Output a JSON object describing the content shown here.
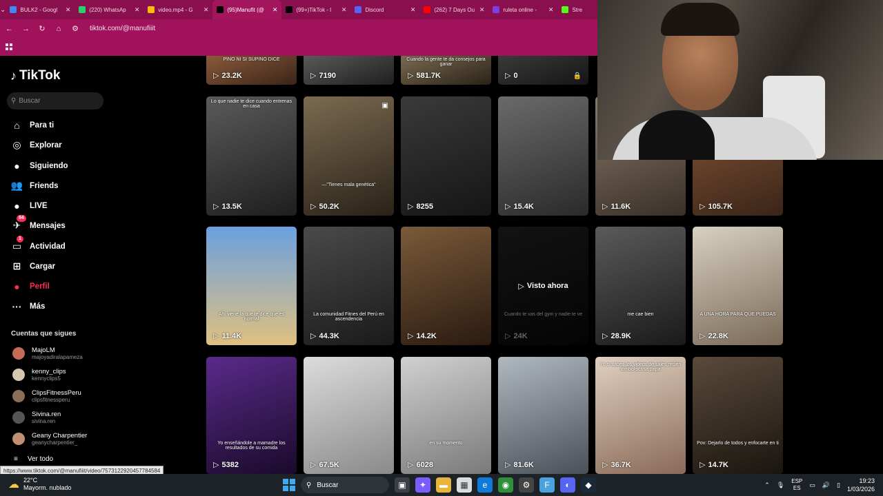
{
  "browser": {
    "tabs": [
      {
        "title": "BULK2 - Googl",
        "color": "#4285f4"
      },
      {
        "title": "(220) WhatsAp",
        "color": "#25d366"
      },
      {
        "title": "video.mp4 - G",
        "color": "#fbbc04"
      },
      {
        "title": "(95)Manufit (@",
        "color": "#000000",
        "active": true
      },
      {
        "title": "(99+)TikTok - l",
        "color": "#000000"
      },
      {
        "title": "Discord",
        "color": "#5865f2"
      },
      {
        "title": "(262) 7 Days Ou",
        "color": "#ff0000"
      },
      {
        "title": "ruleta online -",
        "color": "#7b3fe4"
      },
      {
        "title": "Stre",
        "color": "#53fc18"
      }
    ],
    "url": "tiktok.com/@manufiiit",
    "status_url": "https://www.tiktok.com/@manufiiit/video/7573122920457784584"
  },
  "sidebar": {
    "brand": "TikTok",
    "search_placeholder": "Buscar",
    "nav": [
      {
        "label": "Para ti",
        "icon": "home-icon",
        "glyph": "⌂"
      },
      {
        "label": "Explorar",
        "icon": "compass-icon",
        "glyph": "◎"
      },
      {
        "label": "Siguiendo",
        "icon": "following-avatar-icon",
        "glyph": "●"
      },
      {
        "label": "Friends",
        "icon": "friends-icon",
        "glyph": "👥"
      },
      {
        "label": "LIVE",
        "icon": "live-icon",
        "glyph": "●"
      },
      {
        "label": "Mensajes",
        "icon": "messages-icon",
        "glyph": "✈",
        "badge": "94"
      },
      {
        "label": "Actividad",
        "icon": "activity-icon",
        "glyph": "▭",
        "badge": "1"
      },
      {
        "label": "Cargar",
        "icon": "upload-icon",
        "glyph": "⊞"
      },
      {
        "label": "Perfil",
        "icon": "profile-icon",
        "glyph": "●",
        "active": true
      },
      {
        "label": "Más",
        "icon": "more-icon",
        "glyph": "···"
      }
    ],
    "following_title": "Cuentas que sigues",
    "following": [
      {
        "name": "MajoLM",
        "handle": "majoyadiralapameza"
      },
      {
        "name": "kenny_clips",
        "handle": "kennyclips5"
      },
      {
        "name": "ClipsFitnessPeru",
        "handle": "clipsfitnessperu"
      },
      {
        "name": "Sivina.ren",
        "handle": "sivina.ren"
      },
      {
        "name": "Geany Charpentier",
        "handle": "geanycharpentier_"
      }
    ],
    "see_all": "Ver todo"
  },
  "grid": {
    "row0": [
      {
        "views": "23.2K",
        "caption": "PINO NI SI SUPINO DICE"
      },
      {
        "views": "7190"
      },
      {
        "views": "581.7K",
        "caption": "Cuando la gente te da consejos para ganar"
      },
      {
        "views": "0",
        "locked": true
      }
    ],
    "row1": [
      {
        "views": "13.5K",
        "caption": "Lo que nadie te dice cuando entrenas en casa"
      },
      {
        "views": "50.2K",
        "caption": "—\"Tienes mala genética\""
      },
      {
        "views": "8255"
      },
      {
        "views": "15.4K"
      },
      {
        "views": "11.6K"
      },
      {
        "views": "105.7K"
      }
    ],
    "row2": [
      {
        "views": "11.4K",
        "caption": "Ahí viene la que te dice que es normal"
      },
      {
        "views": "44.3K",
        "caption": "La comunidad Fitnes del Perú en ascendencia"
      },
      {
        "views": "14.2K"
      },
      {
        "views": "24K",
        "overlay": "Visto ahora",
        "caption": "Cuando te vas del gym y nadie te ve"
      },
      {
        "views": "28.9K",
        "caption": "me cae bien"
      },
      {
        "views": "22.8K",
        "caption": "A UNA HORA PARA QUE PUEDAS"
      }
    ],
    "row3": [
      {
        "views": "5382",
        "caption": "Yo enseñándole a mamadre los resultados de su comida"
      },
      {
        "views": "67.5K"
      },
      {
        "views": "6028",
        "caption": "en su momento"
      },
      {
        "views": "81.6K"
      },
      {
        "views": "36.7K",
        "caption": "Yo si sabes los videos de sales recién tomborocosa papa"
      },
      {
        "views": "14.7K",
        "caption": "Pov: Dejarlo de todos y enfocarte en ti"
      }
    ]
  },
  "taskbar": {
    "weather_temp": "22°C",
    "weather_desc": "Mayorm. nublado",
    "search": "Buscar",
    "lang_top": "ESP",
    "lang_bottom": "ES",
    "time": "19:23",
    "date": "1/03/2026"
  }
}
